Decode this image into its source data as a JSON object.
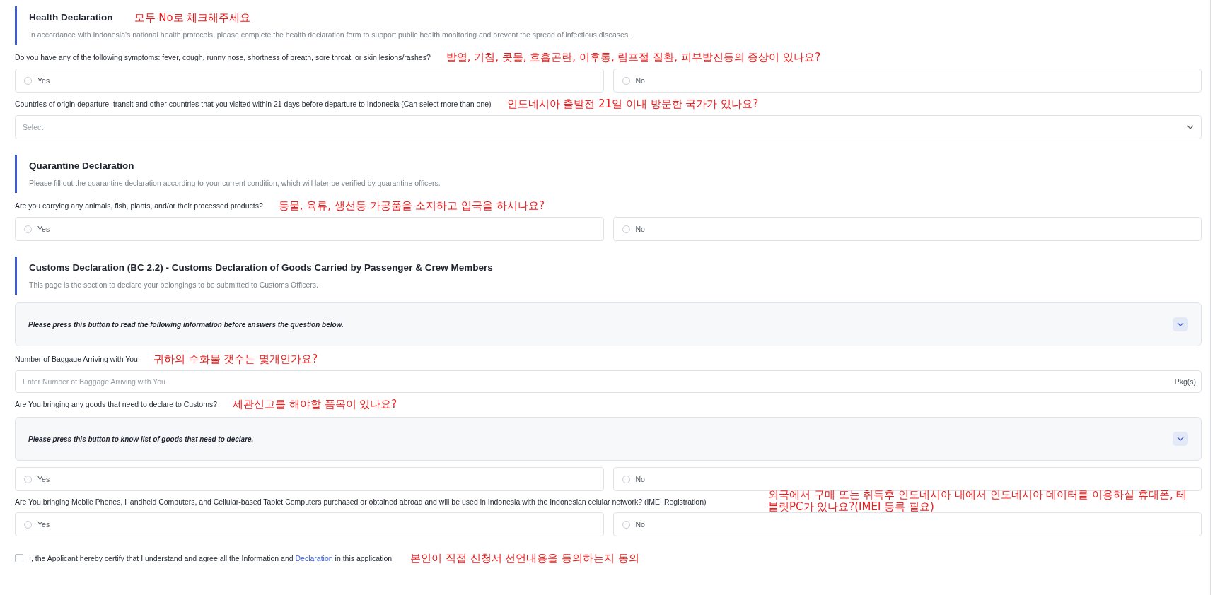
{
  "sections": [
    {
      "title": "Health Declaration",
      "note": "모두 No로 체크해주세요",
      "description": "In accordance with Indonesia's national health protocols, please complete the health declaration form to support public health monitoring and prevent the spread of infectious diseases.",
      "items": [
        {
          "kind": "question",
          "label": "Do you have any of the following symptoms: fever, cough, runny nose, shortness of breath, sore throat, or skin lesions/rashes?",
          "note": "발열, 기침, 콧물, 호흡곤란, 이후통, 림프절 질환, 피부발진등의 증상이 있나요?"
        },
        {
          "kind": "radio",
          "options": [
            {
              "label": "Yes",
              "selected": false
            },
            {
              "label": "No",
              "selected": false
            }
          ]
        },
        {
          "kind": "question",
          "label": "Countries of origin departure, transit and other countries that you visited within 21 days before departure to Indonesia (Can select more than one)",
          "note": "인도네시아 출발전 21일 이내 방문한 국가가 있나요?"
        },
        {
          "kind": "select",
          "placeholder": "Select"
        }
      ]
    },
    {
      "title": "Quarantine Declaration",
      "description": "Please fill out the quarantine declaration according to your current condition, which will later be verified by quarantine officers.",
      "items": [
        {
          "kind": "question",
          "label": "Are you carrying any animals, fish, plants, and/or their processed products?",
          "note": "동물, 육류, 생선등 가공품을 소지하고 입국을 하시나요?"
        },
        {
          "kind": "radio",
          "options": [
            {
              "label": "Yes",
              "selected": false
            },
            {
              "label": "No",
              "selected": false
            }
          ]
        }
      ]
    },
    {
      "title": "Customs Declaration (BC 2.2) - Customs Declaration of Goods Carried by Passenger & Crew Members",
      "description": "This page is the section to declare your belongings to be submitted to Customs Officers.",
      "items": [
        {
          "kind": "accordion",
          "text": "Please press this button to read the following information before answers the question below.",
          "expanded": false
        },
        {
          "kind": "question",
          "label": "Number of Baggage Arriving with You",
          "note": "귀하의 수화물 갯수는 몇개인가요?"
        },
        {
          "kind": "input",
          "placeholder": "Enter Number of Baggage Arriving with You",
          "suffix": "Pkg(s)"
        },
        {
          "kind": "question",
          "label": "Are You bringing any goods that need to declare to Customs?",
          "note": "세관신고를 해야할 품목이 있나요?"
        },
        {
          "kind": "accordion",
          "text": "Please press this button to know list of goods that need to declare.",
          "expanded": false
        },
        {
          "kind": "radio",
          "options": [
            {
              "label": "Yes",
              "selected": false
            },
            {
              "label": "No",
              "selected": false
            }
          ]
        },
        {
          "kind": "question_wide_note",
          "label": "Are You bringing Mobile Phones, Handheld Computers, and Cellular-based Tablet Computers purchased or obtained abroad and will be used in Indonesia with the Indonesian celular network? (IMEI Registration)",
          "note": "외국에서 구매 또는 취득후 인도네시아 내에서 인도네시아 데이터를 이용하실 휴대폰, 테블릿PC가 있나요?(IMEI 등록 필요)"
        },
        {
          "kind": "radio",
          "options": [
            {
              "label": "Yes",
              "selected": false
            },
            {
              "label": "No",
              "selected": false
            }
          ]
        }
      ]
    }
  ],
  "agreement": {
    "checked": false,
    "text_before": "I, the Applicant hereby certify that I understand and agree all the Information and",
    "link": "Declaration",
    "text_after": "in this application",
    "note": "본인이 직접 신청서 선언내용을 동의하는지 동의"
  }
}
